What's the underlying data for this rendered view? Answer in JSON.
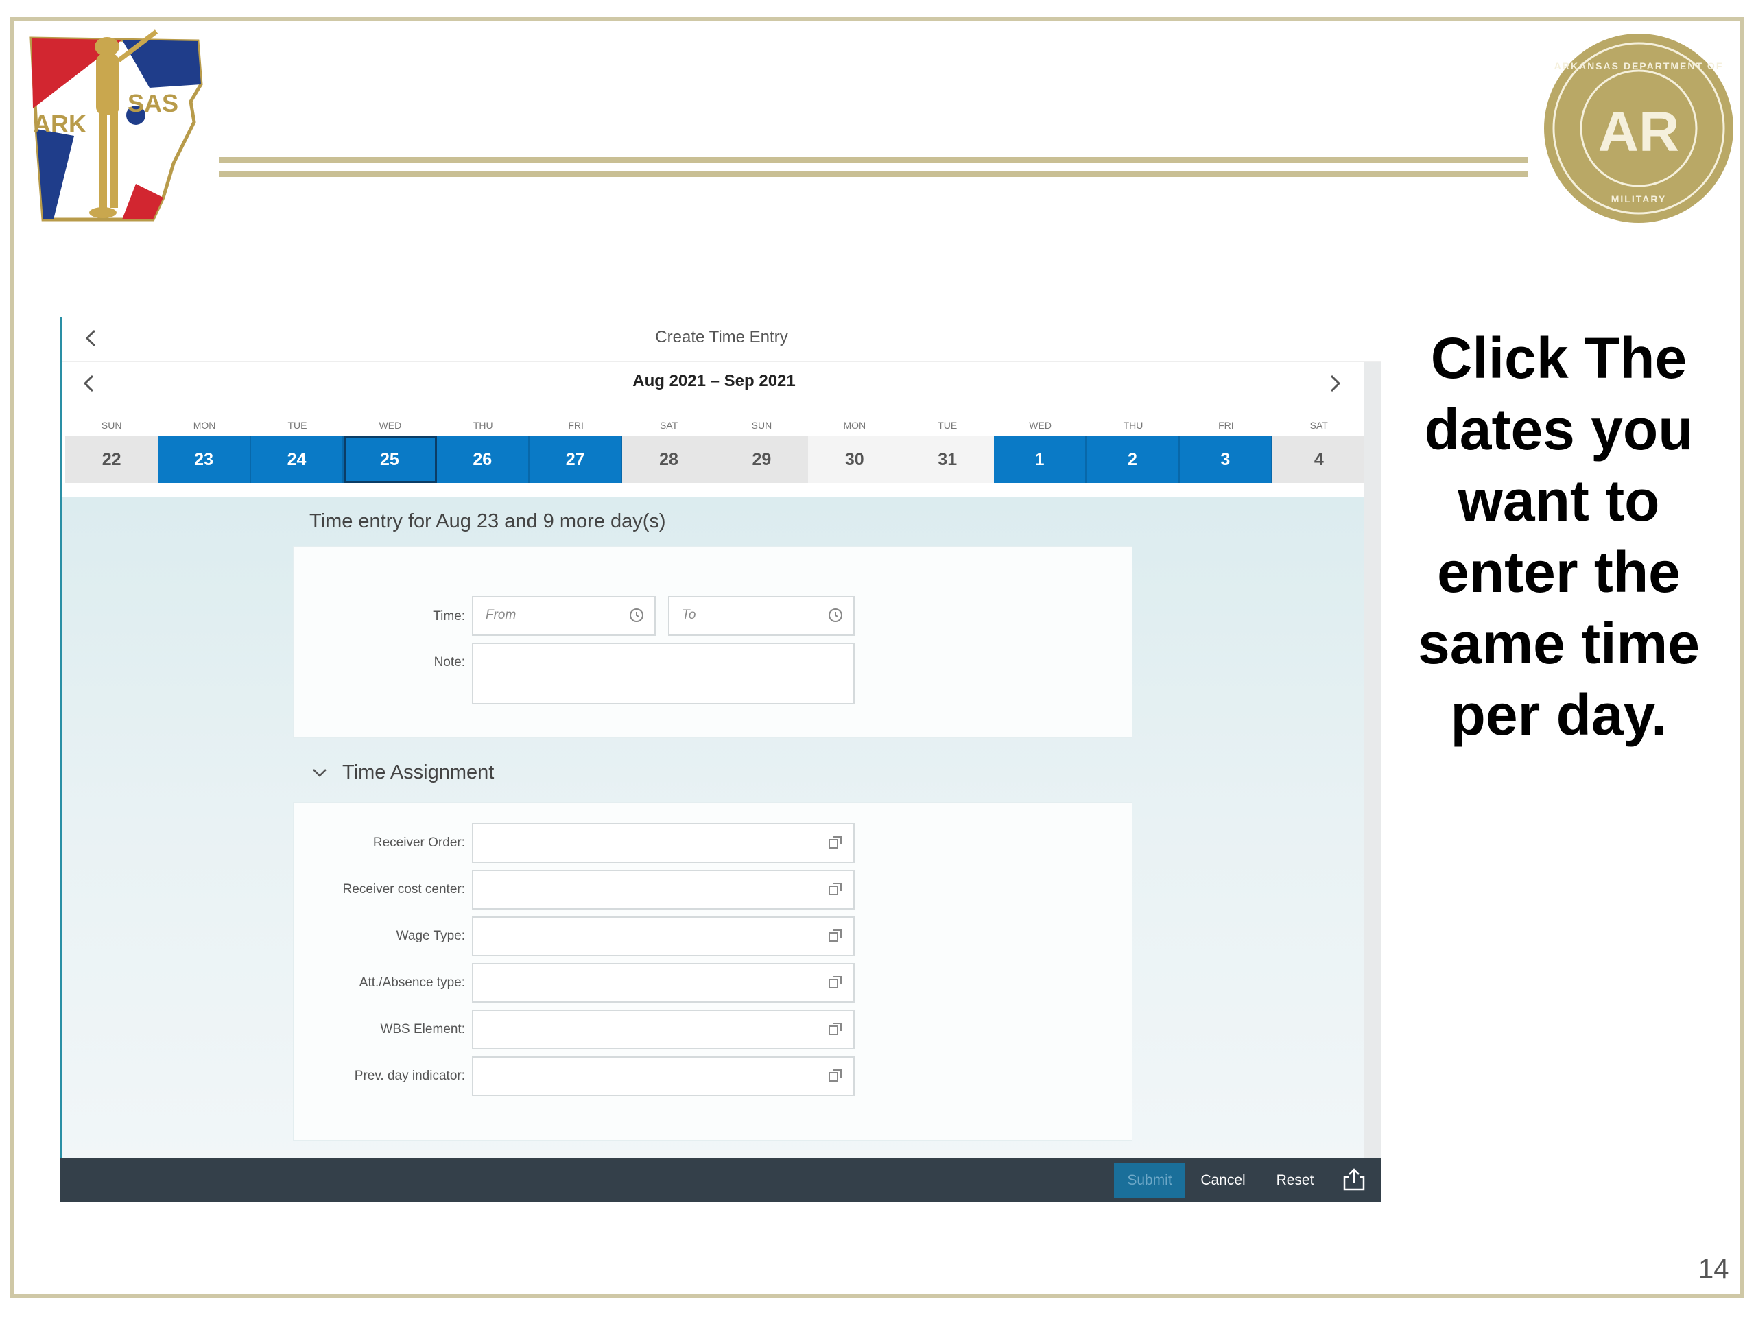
{
  "slide": {
    "instruction": "Click The dates you want to enter the same time per day.",
    "page_number": "14",
    "logo_left_text": "ARKANSAS",
    "seal_text_top": "ARKANSAS DEPARTMENT OF",
    "seal_text_bottom": "MILITARY",
    "seal_monogram": "AR"
  },
  "app": {
    "title": "Create Time Entry",
    "calendar": {
      "range_label": "Aug 2021 – Sep 2021",
      "days": [
        {
          "dow": "SUN",
          "num": "22",
          "selected": false
        },
        {
          "dow": "MON",
          "num": "23",
          "selected": true
        },
        {
          "dow": "TUE",
          "num": "24",
          "selected": true
        },
        {
          "dow": "WED",
          "num": "25",
          "selected": true
        },
        {
          "dow": "THU",
          "num": "26",
          "selected": true
        },
        {
          "dow": "FRI",
          "num": "27",
          "selected": true
        },
        {
          "dow": "SAT",
          "num": "28",
          "selected": false
        },
        {
          "dow": "SUN",
          "num": "29",
          "selected": false
        },
        {
          "dow": "MON",
          "num": "30",
          "selected": false
        },
        {
          "dow": "TUE",
          "num": "31",
          "selected": false
        },
        {
          "dow": "WED",
          "num": "1",
          "selected": true
        },
        {
          "dow": "THU",
          "num": "2",
          "selected": true
        },
        {
          "dow": "FRI",
          "num": "3",
          "selected": true
        },
        {
          "dow": "SAT",
          "num": "4",
          "selected": false
        }
      ]
    },
    "entry_heading": "Time entry for Aug 23 and 9 more day(s)",
    "time_label": "Time:",
    "from_placeholder": "From",
    "to_placeholder": "To",
    "note_label": "Note:",
    "section_title": "Time Assignment",
    "assignment_fields": [
      {
        "label": "Receiver Order:"
      },
      {
        "label": "Receiver cost center:"
      },
      {
        "label": "Wage Type:"
      },
      {
        "label": "Att./Absence type:"
      },
      {
        "label": "WBS Element:"
      },
      {
        "label": "Prev. day indicator:"
      }
    ],
    "footer": {
      "submit": "Submit",
      "cancel": "Cancel",
      "reset": "Reset"
    }
  },
  "colors": {
    "accent": "#0a7ac6",
    "footer_bg": "#34404a",
    "rule": "#c9bf94"
  }
}
